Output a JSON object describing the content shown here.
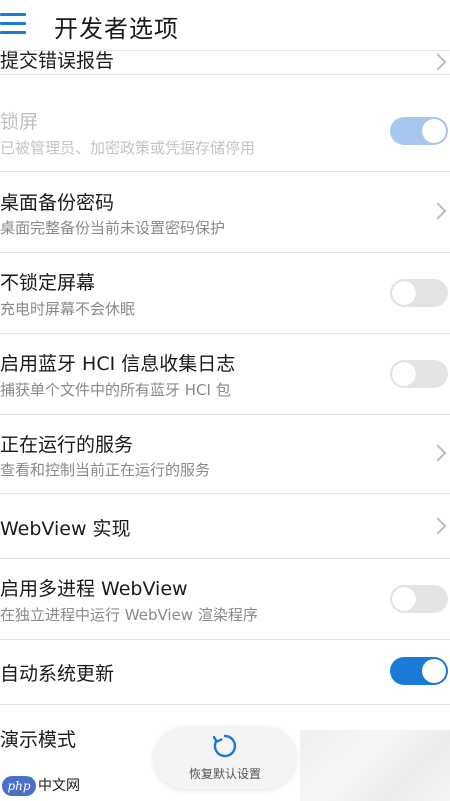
{
  "header": {
    "title": "开发者选项"
  },
  "rows": [
    {
      "title": "提交错误报告",
      "subtitle": "",
      "control": "chevron"
    },
    {
      "title": "锁屏",
      "subtitle": "已被管理员、加密政策或凭据存储停用",
      "control": "toggle",
      "on": true,
      "disabled": true
    },
    {
      "title": "桌面备份密码",
      "subtitle": "桌面完整备份当前未设置密码保护",
      "control": "chevron"
    },
    {
      "title": "不锁定屏幕",
      "subtitle": "充电时屏幕不会休眠",
      "control": "toggle",
      "on": false
    },
    {
      "title": "启用蓝牙 HCI 信息收集日志",
      "subtitle": "捕获单个文件中的所有蓝牙 HCI 包",
      "control": "toggle",
      "on": false
    },
    {
      "title": "正在运行的服务",
      "subtitle": "查看和控制当前正在运行的服务",
      "control": "chevron"
    },
    {
      "title": "WebView 实现",
      "subtitle": "",
      "control": "chevron"
    },
    {
      "title": "启用多进程 WebView",
      "subtitle": "在独立进程中运行 WebView 渲染程序",
      "control": "toggle",
      "on": false
    },
    {
      "title": "自动系统更新",
      "subtitle": "",
      "control": "toggle",
      "on": true
    },
    {
      "title": "演示模式",
      "subtitle": "",
      "control": "chevron"
    }
  ],
  "restore_button": {
    "label": "恢复默认设置"
  },
  "watermark": {
    "badge": "php",
    "text": "中文网"
  },
  "colors": {
    "accent": "#1a7ad6",
    "toggle_off": "#e4e4e4",
    "toggle_on_disabled": "#a7c8ee"
  }
}
